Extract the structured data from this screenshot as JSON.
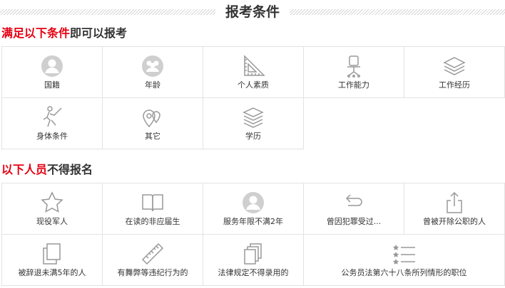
{
  "header": {
    "title": "报考条件"
  },
  "section1": {
    "title_red": "满足以下条件",
    "title_rest": "即可以报考",
    "items": [
      {
        "label": "国籍",
        "icon": "person-circle-icon"
      },
      {
        "label": "年龄",
        "icon": "group-circle-icon"
      },
      {
        "label": "个人素质",
        "icon": "ruler-triangle-icon"
      },
      {
        "label": "工作能力",
        "icon": "office-chair-icon"
      },
      {
        "label": "工作经历",
        "icon": "layers-icon"
      },
      {
        "label": "身体条件",
        "icon": "fencing-icon"
      },
      {
        "label": "其它",
        "icon": "location-pins-icon"
      },
      {
        "label": "学历",
        "icon": "stacked-layers-icon"
      }
    ]
  },
  "section2": {
    "title_red": "以下人员",
    "title_rest": "不得报名",
    "items": [
      {
        "label": "现役军人",
        "icon": "star-icon"
      },
      {
        "label": "在读的非应届生",
        "icon": "open-book-icon"
      },
      {
        "label": "服务年限不满2年",
        "icon": "person-circle-icon"
      },
      {
        "label": "曾因犯罪受过...",
        "icon": "return-arrow-icon"
      },
      {
        "label": "曾被开除公职的人",
        "icon": "share-upload-icon"
      },
      {
        "label": "被辞退未满5年的人",
        "icon": "copy-pages-icon"
      },
      {
        "label": "有舞弊等违纪行为的",
        "icon": "ruler-icon"
      },
      {
        "label": "法律规定不得录用的",
        "icon": "documents-icon"
      },
      {
        "label": "公务员法第六十八条所列情形的职位",
        "icon": "star-list-icon"
      }
    ]
  }
}
